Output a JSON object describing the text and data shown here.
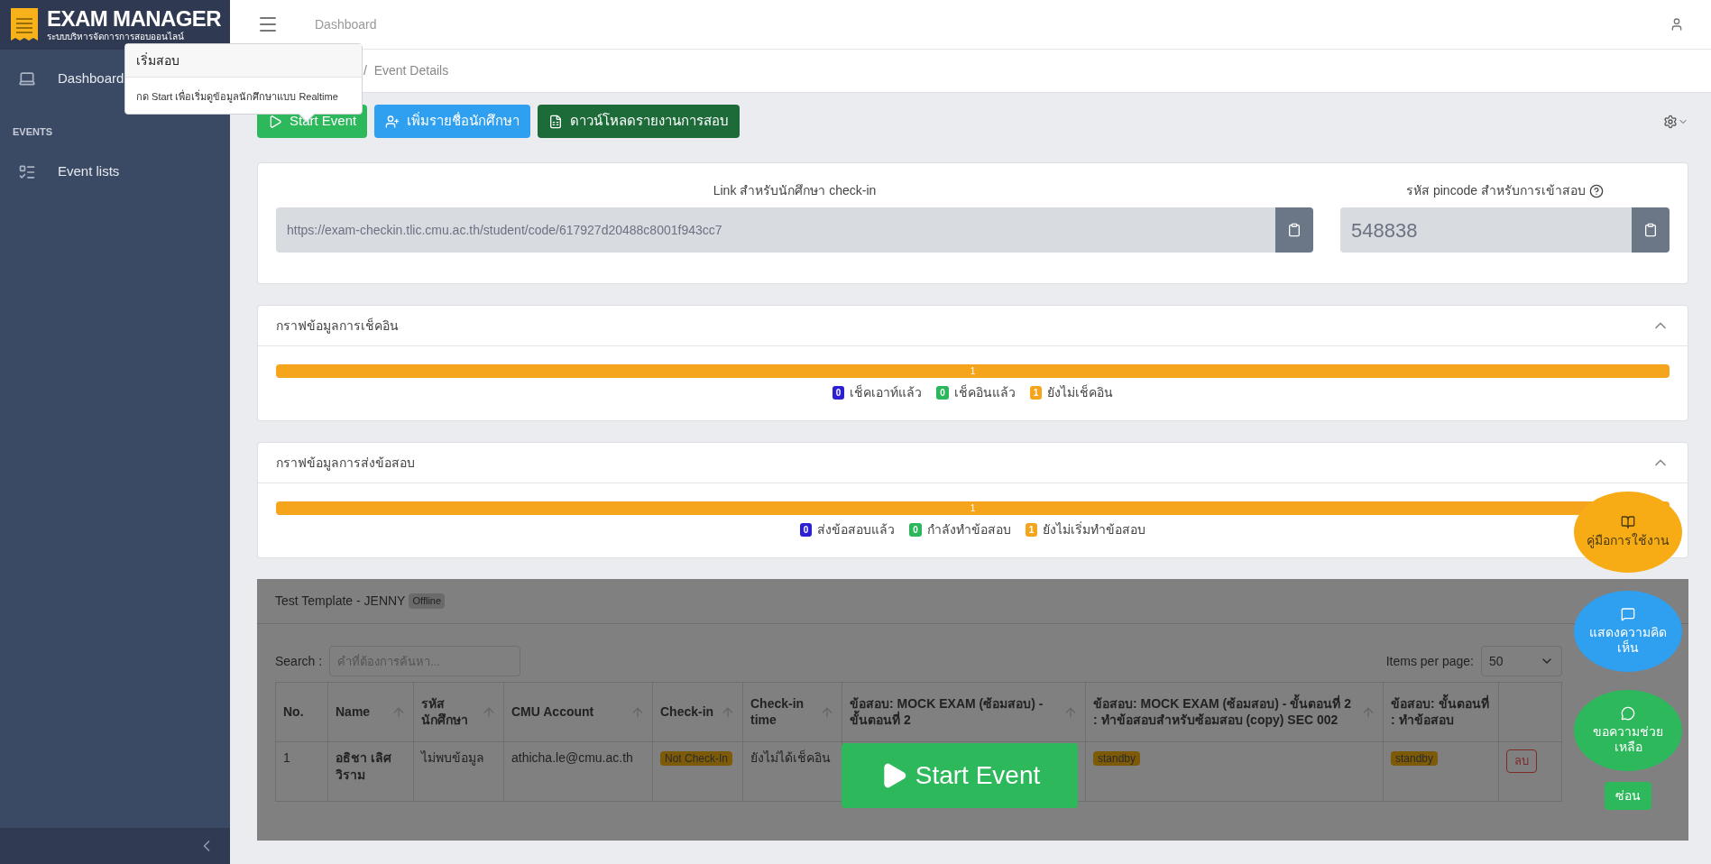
{
  "sidebar": {
    "logo": {
      "title": "EXAM MANAGER",
      "subtitle": "ระบบบริหารจัดการการสอบออนไลน์"
    },
    "items": [
      {
        "label": "Dashboard",
        "selected": false,
        "kind": "dashboard"
      }
    ],
    "section": "EVENTS",
    "section_items": [
      {
        "label": "Event lists",
        "selected": false,
        "kind": "list"
      }
    ]
  },
  "header": {
    "title": "Dashboard"
  },
  "breadcrumb": "/  Event Details",
  "popover": {
    "title": "เริ่มสอบ",
    "body": "กด Start เพื่อเริ่มดูข้อมูลนักศึกษาแบบ Realtime"
  },
  "toolbar": [
    {
      "label": "Start Event",
      "kind": "start"
    },
    {
      "label": "เพิ่มรายชื่อนักศึกษา",
      "kind": "add"
    },
    {
      "label": "ดาวน์โหลดรายงานการสอบ",
      "kind": "excel"
    }
  ],
  "links": [
    {
      "label": "Link สำหรับนักศึกษา check-in",
      "value": "https://exam-checkin.tlic.cmu.ac.th/student/code/617927d20488c8001f943cc7",
      "kind": "link"
    },
    {
      "label": "รหัส pincode สำหรับการเข้าสอบ",
      "value": "548838",
      "kind": "pin"
    }
  ],
  "charts": [
    {
      "title": "กราฟข้อมูลการเช็คอิน",
      "expanded": true,
      "segments": [
        {
          "count": "1",
          "level": 1,
          "color": "#f5a51c"
        }
      ],
      "legend": [
        {
          "count": "0",
          "label": "เช็คเอาท์แล้ว",
          "color": "#2d1fd3"
        },
        {
          "count": "0",
          "label": "เช็คอินแล้ว",
          "color": "#2bb75c"
        },
        {
          "count": "1",
          "label": "ยังไม่เช็คอิน",
          "color": "#f5a51c"
        }
      ]
    },
    {
      "title": "กราฟข้อมูลการส่งข้อสอบ",
      "expanded": true,
      "segments": [
        {
          "count": "1",
          "level": 1,
          "color": "#f5a51c"
        }
      ],
      "legend": [
        {
          "count": "0",
          "label": "ส่งข้อสอบแล้ว",
          "color": "#2d1fd3"
        },
        {
          "count": "0",
          "label": "กำลังทำข้อสอบ",
          "color": "#2bb75c"
        },
        {
          "count": "1",
          "label": "ยังไม่เริ่มทำข้อสอบ",
          "color": "#f5a51c"
        }
      ]
    }
  ],
  "event": {
    "title": "Test Template - JENNY",
    "status": "Offline",
    "search": {
      "label": "Search :",
      "placeholder": "คำที่ต้องการค้นหา..."
    },
    "items_per_page": {
      "label": "Items per page:",
      "value": "50"
    },
    "columns": [
      {
        "label": "No.",
        "sortable": false
      },
      {
        "label": "Name",
        "sortable": true
      },
      {
        "label": "รหัส นักศึกษา",
        "sortable": true
      },
      {
        "label": "CMU Account",
        "sortable": true
      },
      {
        "label": "Check-in",
        "sortable": true
      },
      {
        "label": "Check-in time",
        "sortable": true
      },
      {
        "label": "ข้อสอบ: MOCK EXAM (ซ้อมสอบ) - ขั้นตอนที่ 2",
        "sortable": true
      },
      {
        "label": "ข้อสอบ: MOCK EXAM (ซ้อมสอบ) - ขั้นตอนที่ 2 : ทำข้อสอบสำหรับซ้อมสอบ (copy) SEC 002",
        "sortable": true
      },
      {
        "label": "ข้อสอบ: ขั้นตอนที่ : ทำข้อสอบ",
        "sortable": false
      }
    ],
    "rows": [
      [
        {
          "kind": "text",
          "text": "1"
        },
        {
          "kind": "bold",
          "text": "อธิชา เลิศวิราม"
        },
        {
          "kind": "text",
          "text": "ไม่พบข้อมูล"
        },
        {
          "kind": "text",
          "text": "athicha.le@cmu.ac.th"
        },
        {
          "kind": "badge",
          "text": "Not Check-In"
        },
        {
          "kind": "text",
          "text": "ยังไม่ได้เช็คอิน"
        },
        {
          "kind": "covered"
        },
        {
          "kind": "badge",
          "text": "standby"
        },
        {
          "kind": "badge",
          "text": "standby"
        },
        {
          "kind": "delete",
          "text": "ลบ"
        }
      ]
    ],
    "start_button": "Start Event"
  },
  "floating": [
    {
      "label": "คู่มือการใช้งาน",
      "kind": "manual"
    },
    {
      "label": "แสดงความคิดเห็น",
      "kind": "feedback"
    },
    {
      "label": "ขอความช่วยเหลือ",
      "kind": "help"
    }
  ],
  "hide_button": "ซ่อน"
}
